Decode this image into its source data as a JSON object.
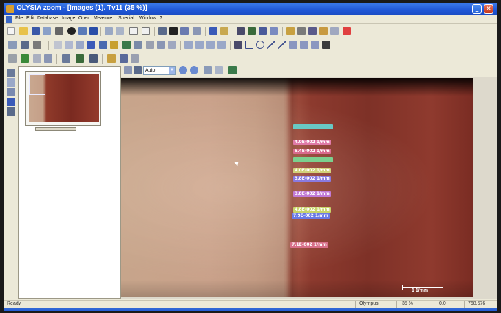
{
  "window": {
    "title": "OLYSIA zoom - [Images (1). Tv11 (35 %)]",
    "minimize_glyph": "_",
    "close_glyph": "✕"
  },
  "menu": [
    "File",
    "Edit",
    "Database",
    "Image",
    "Oper",
    "Measure",
    "Special",
    "Window",
    "?"
  ],
  "image_toolbar": {
    "zoom_value": "Auto"
  },
  "measurements": [
    {
      "text": "",
      "bg": "#69c8c4",
      "fg": "#ffffff"
    },
    {
      "text": "4.0E-002 1/mm",
      "bg": "#e07aa8",
      "fg": "#ffffff"
    },
    {
      "text": "5.4E-002 1/mm",
      "bg": "#d96a8e",
      "fg": "#ffffff"
    },
    {
      "text": "",
      "bg": "#7bd08e",
      "fg": "#ffffff"
    },
    {
      "text": "4.0E-002 1/mm",
      "bg": "#d2d27a",
      "fg": "#ffffff"
    },
    {
      "text": "3.8E-002 1/mm",
      "bg": "#8a7ae0",
      "fg": "#ffffff"
    },
    {
      "text": "3.8E-002 1/mm",
      "bg": "#c27ad6",
      "fg": "#ffffff"
    },
    {
      "text": "4.8E-002 1/mm",
      "bg": "#c8d46a",
      "fg": "#ffffff"
    },
    {
      "text": "7.9E-002 1/mm",
      "bg": "#6a7ae6",
      "fg": "#ffffff"
    },
    {
      "text": "7.1E-002 1/mm",
      "bg": "#d8708a",
      "fg": "#ffffff"
    }
  ],
  "scale_bar": {
    "label": "1 1/mm"
  },
  "status": {
    "left": "Ready",
    "camera": "Olympus",
    "zoom": "35 %",
    "cursor_pos": "0,0",
    "image_size": "768,576"
  }
}
